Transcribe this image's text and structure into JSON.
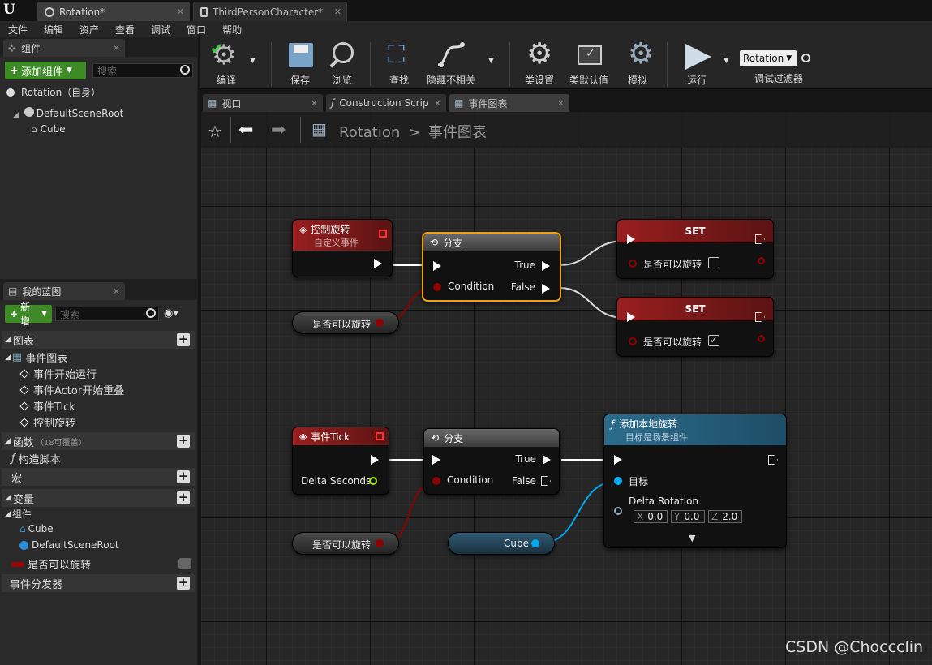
{
  "tabs": [
    "Rotation*",
    "ThirdPersonCharacter*"
  ],
  "menu": [
    "文件",
    "编辑",
    "资产",
    "查看",
    "调试",
    "窗口",
    "帮助"
  ],
  "components_panel": {
    "title": "组件",
    "add_button": "添加组件",
    "search_placeholder": "搜索",
    "root": "Rotation（自身）",
    "tree": [
      "DefaultSceneRoot",
      "Cube"
    ]
  },
  "my_blueprint": {
    "title": "我的蓝图",
    "new_button": "新增",
    "search_placeholder": "搜索",
    "graphs_header": "图表",
    "event_graph": "事件图表",
    "events": [
      "事件开始运行",
      "事件Actor开始重叠",
      "事件Tick",
      "控制旋转"
    ],
    "functions_header": "函数",
    "functions_note": "（18可覆盖）",
    "construct_script": "构造脚本",
    "macros_header": "宏",
    "variables_header": "变量",
    "components_header": "组件",
    "components": [
      "Cube",
      "DefaultSceneRoot"
    ],
    "variable": "是否可以旋转",
    "dispatchers_header": "事件分发器"
  },
  "toolbar": {
    "compile": "编译",
    "save": "保存",
    "browse": "浏览",
    "find": "查找",
    "hide_unrelated": "隐藏不相关",
    "class_settings": "类设置",
    "class_defaults": "类默认值",
    "simulate": "模拟",
    "play": "运行",
    "debug_object": "Rotation",
    "debug_filter": "调试过滤器"
  },
  "graph_tabs": [
    "视口",
    "Construction Scrip",
    "事件图表"
  ],
  "breadcrumb": {
    "blueprint": "Rotation",
    "graph": "事件图表"
  },
  "nodes": {
    "custom_event": {
      "title": "控制旋转",
      "subtitle": "自定义事件"
    },
    "branch1": {
      "title": "分支",
      "condition": "Condition",
      "true": "True",
      "false": "False"
    },
    "set1": {
      "title": "SET",
      "var": "是否可以旋转",
      "checked": false
    },
    "set2": {
      "title": "SET",
      "var": "是否可以旋转",
      "checked": true
    },
    "get1": {
      "label": "是否可以旋转"
    },
    "event_tick": {
      "title": "事件Tick",
      "delta": "Delta Seconds"
    },
    "branch2": {
      "title": "分支",
      "condition": "Condition",
      "true": "True",
      "false": "False"
    },
    "get2": {
      "label": "是否可以旋转"
    },
    "cube_ref": {
      "label": "Cube"
    },
    "add_rotation": {
      "title": "添加本地旋转",
      "subtitle": "目标是场景组件",
      "target": "目标",
      "delta_rotation": "Delta Rotation",
      "x": "0.0",
      "y": "0.0",
      "z": "2.0",
      "x_label": "X",
      "y_label": "Y",
      "z_label": "Z"
    }
  },
  "watermark": "CSDN @Choccclin",
  "colors": {
    "exec": "#ffffff",
    "bool": "#8c0000",
    "object": "#00a8f0",
    "float": "#9cf000",
    "selected": "#f0a010"
  }
}
